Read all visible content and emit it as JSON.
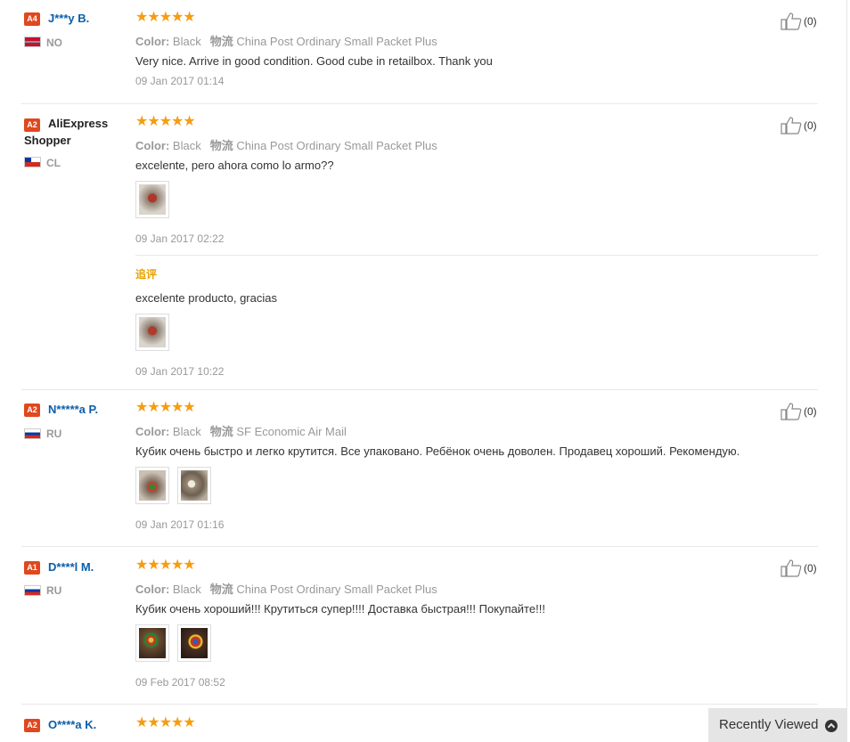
{
  "reviews": [
    {
      "badge": "A4",
      "name": "J***y B.",
      "country": "NO",
      "stars": "★★★★★",
      "color_label": "Color:",
      "color_value": "Black",
      "ship_label": "物流",
      "ship_value": "China Post Ordinary Small Packet Plus",
      "text": "Very nice. Arrive in good condition. Good cube in retailbox. Thank you",
      "date": "09 Jan 2017 01:14",
      "likes": "(0)"
    },
    {
      "badge": "A2",
      "name_line1": "AliExpress",
      "name_line2": "Shopper",
      "country": "CL",
      "stars": "★★★★★",
      "color_label": "Color:",
      "color_value": "Black",
      "ship_label": "物流",
      "ship_value": "China Post Ordinary Small Packet Plus",
      "text": "excelente, pero ahora como lo armo??",
      "date": "09 Jan 2017 02:22",
      "likes": "(0)",
      "followup_label": "追评",
      "followup_text": "excelente producto, gracias",
      "followup_date": "09 Jan 2017 10:22"
    },
    {
      "badge": "A2",
      "name": "N*****a P.",
      "country": "RU",
      "stars": "★★★★★",
      "color_label": "Color:",
      "color_value": "Black",
      "ship_label": "物流",
      "ship_value": "SF Economic Air Mail",
      "text": "Кубик очень быстро и легко крутится. Все упаковано. Ребёнок очень доволен. Продавец хороший. Рекомендую.",
      "date": "09 Jan 2017 01:16",
      "likes": "(0)"
    },
    {
      "badge": "A1",
      "name": "D****l M.",
      "country": "RU",
      "stars": "★★★★★",
      "color_label": "Color:",
      "color_value": "Black",
      "ship_label": "物流",
      "ship_value": "China Post Ordinary Small Packet Plus",
      "text": "Кубик очень хороший!!! Крутиться супер!!!! Доставка быстрая!!! Покупайте!!!",
      "date": "09 Feb 2017 08:52",
      "likes": "(0)"
    },
    {
      "badge": "A2",
      "name": "O****a K.",
      "stars": "★★★★★"
    }
  ],
  "recently_viewed": "Recently Viewed",
  "colors": {
    "accent": "#0b5ea8",
    "star": "#f59d12",
    "badge": "#e0481e",
    "followup": "#e8a100"
  }
}
